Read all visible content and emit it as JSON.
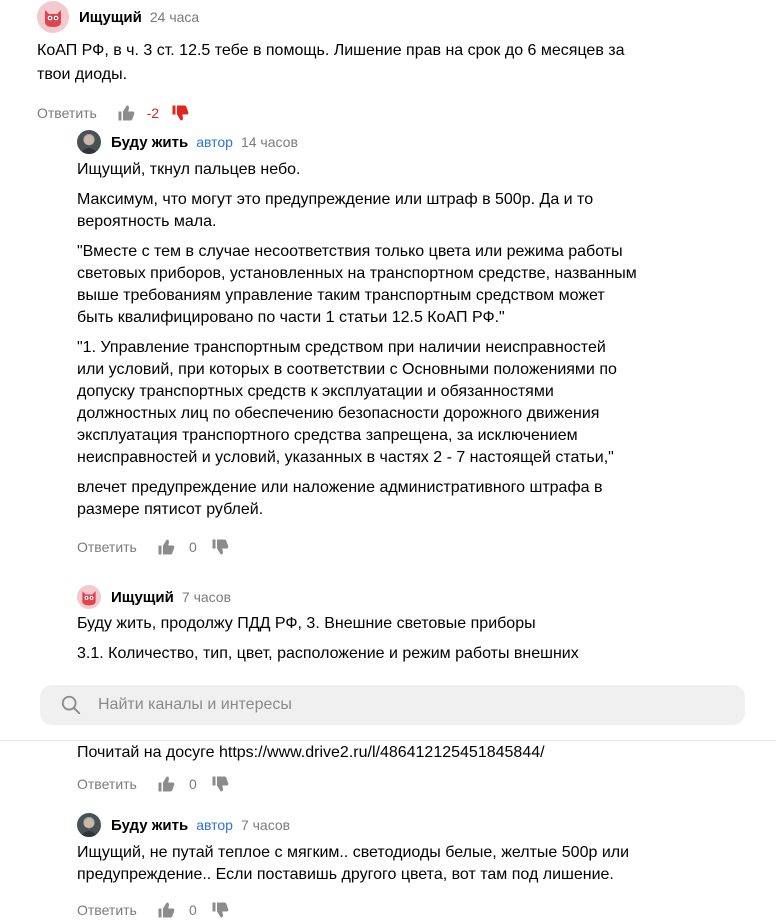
{
  "comments": [
    {
      "author": "Ищущий",
      "time": "24 часа",
      "paragraphs": [
        "КоАП РФ, в ч. 3 ст. 12.5 тебе в помощь. Лишение прав на срок до 6 месяцев за твои диоды."
      ],
      "reply_label": "Ответить",
      "likes": "-2"
    },
    {
      "author": "Буду жить",
      "badge": "автор",
      "time": "14 часов",
      "paragraphs": [
        "Ищущий, ткнул пальцев небо.",
        "Максимум, что могут это предупреждение или штраф в 500р. Да и то вероятность мала.",
        "\"Вместе с тем в случае несоответствия только цвета или режима работы световых приборов, установленных на транспортном средстве, названным выше требованиям управление таким транспортным средством может быть квалифицировано по части 1 статьи 12.5 КоАП РФ.\"",
        "\"1. Управление транспортным средством при наличии неисправностей или условий, при которых в соответствии с Основными положениями по допуску транспортных средств к эксплуатации и обязанностями должностных лиц по обеспечению безопасности дорожного движения эксплуатация транспортного средства запрещена, за исключением неисправностей и условий, указанных в частях 2 - 7 настоящей статьи,\"",
        "влечет предупреждение или наложение административного штрафа в размере пятисот рублей."
      ],
      "reply_label": "Ответить",
      "likes": "0"
    },
    {
      "author": "Ищущий",
      "time": "7 часов",
      "paragraphs": [
        "Буду жить, продолжу ПДД РФ, 3. Внешние световые приборы",
        "3.1. Количество, тип, цвет, расположение и режим работы внешних",
        "Почитай на досуге https://www.drive2.ru/l/486412125451845844/"
      ],
      "reply_label": "Ответить",
      "likes": "0"
    },
    {
      "author": "Буду жить",
      "badge": "автор",
      "time": "7 часов",
      "paragraphs": [
        "Ищущий, не путай теплое с мягким.. светодиоды белые, желтые 500р или предупреждение.. Если поставишь другого цвета, вот там под лишение."
      ],
      "reply_label": "Ответить",
      "likes": "0"
    }
  ],
  "search": {
    "placeholder": "Найти каналы и интересы"
  },
  "colors": {
    "accent_blue": "#2a73d9",
    "negative_red": "#e0251b",
    "muted": "#7b7b7b"
  }
}
